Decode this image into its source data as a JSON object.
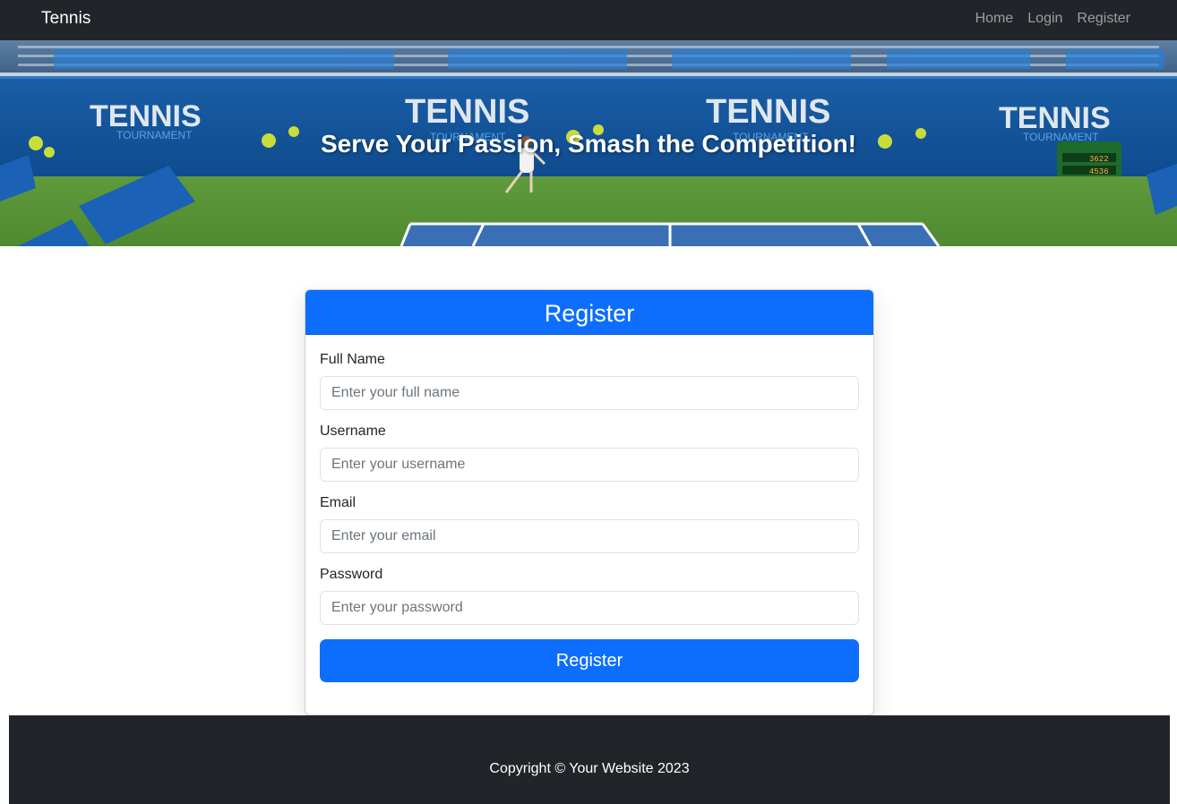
{
  "navbar": {
    "brand": "Tennis",
    "links": [
      "Home",
      "Login",
      "Register"
    ]
  },
  "hero": {
    "title": "Serve Your Passion, Smash the Competition!",
    "banner_texts": [
      "TENNIS",
      "TOURNAMENT"
    ],
    "scoreboard_values": [
      "3622",
      "4536"
    ]
  },
  "form": {
    "title": "Register",
    "fields": [
      {
        "label": "Full Name",
        "placeholder": "Enter your full name",
        "value": ""
      },
      {
        "label": "Username",
        "placeholder": "Enter your username",
        "value": ""
      },
      {
        "label": "Email",
        "placeholder": "Enter your email",
        "value": ""
      },
      {
        "label": "Password",
        "placeholder": "Enter your password",
        "value": ""
      }
    ],
    "submit_label": "Register"
  },
  "footer": {
    "text": "Copyright © Your Website 2023"
  },
  "colors": {
    "navbar_bg": "#212529",
    "primary": "#0d6efd",
    "footer_bg": "#212529"
  }
}
